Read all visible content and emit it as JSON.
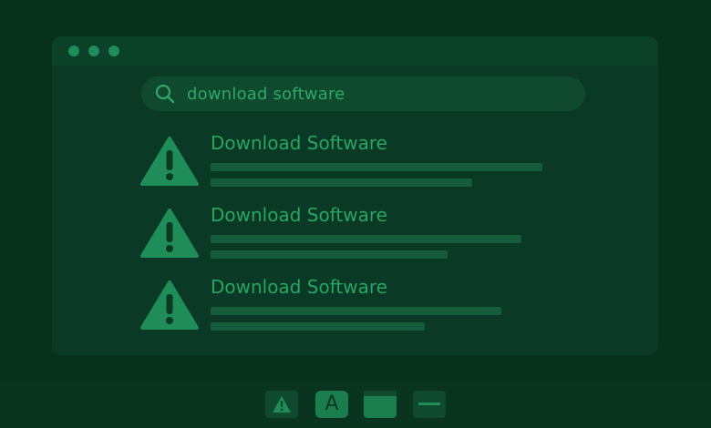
{
  "search": {
    "query": "download software"
  },
  "results": [
    {
      "title": "Download Software",
      "icon": "warning-icon"
    },
    {
      "title": "Download Software",
      "icon": "warning-icon"
    },
    {
      "title": "Download Software",
      "icon": "warning-icon"
    }
  ],
  "taskbar": {
    "items": [
      "warning-icon",
      "font-a-icon",
      "window-icon",
      "minimize-icon"
    ],
    "a_label": "A"
  },
  "colors": {
    "background": "#07301d",
    "window": "#0a3a25",
    "accent": "#28a566",
    "placeholder_line": "#145c3a"
  }
}
